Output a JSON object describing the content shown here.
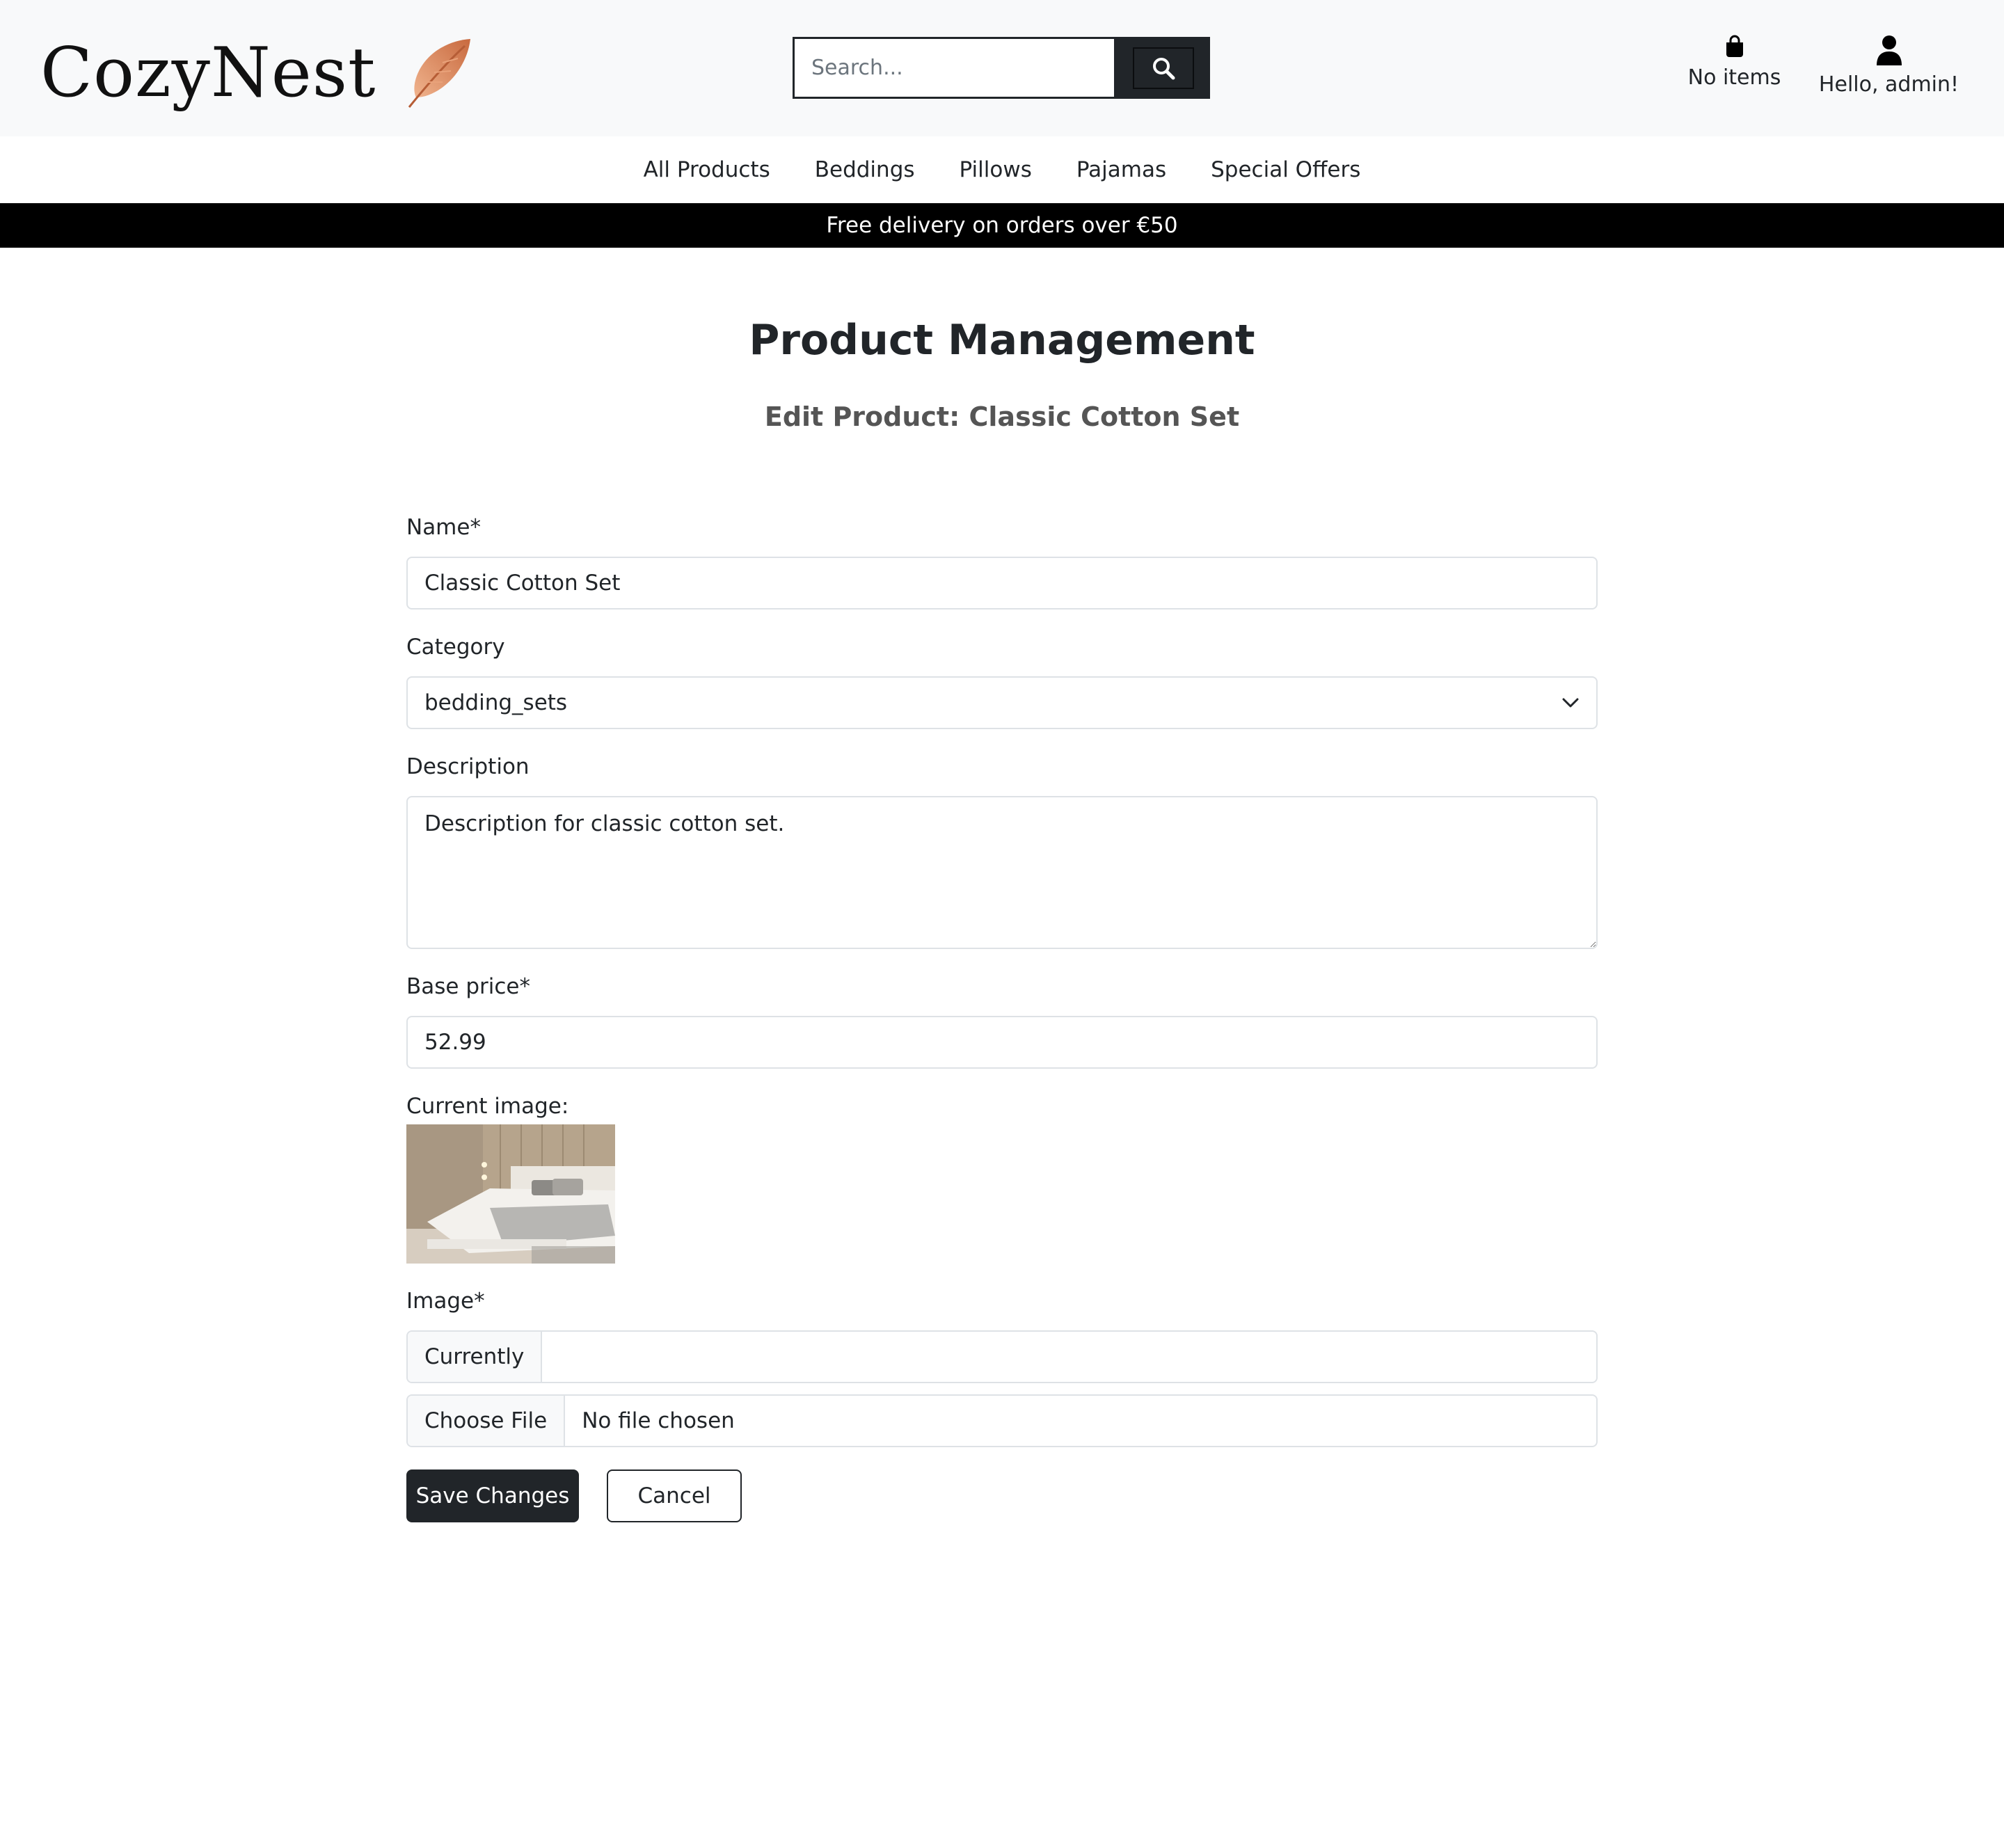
{
  "brand": {
    "name": "CozyNest",
    "icon": "feather-icon"
  },
  "search": {
    "placeholder": "Search...",
    "icon": "search-icon"
  },
  "header": {
    "bag_label": "No items",
    "user_label": "Hello, admin!"
  },
  "nav": {
    "items": [
      "All Products",
      "Beddings",
      "Pillows",
      "Pajamas",
      "Special Offers"
    ]
  },
  "banner": {
    "text": "Free delivery on orders over €50"
  },
  "page": {
    "title": "Product Management",
    "subtitle": "Edit Product: Classic Cotton Set"
  },
  "form": {
    "name_label": "Name*",
    "name_value": "Classic Cotton Set",
    "category_label": "Category",
    "category_value": "bedding_sets",
    "description_label": "Description",
    "description_value": "Description for classic cotton set.",
    "price_label": "Base price*",
    "price_value": "52.99",
    "current_image_label": "Current image:",
    "image_label": "Image*",
    "currently_label": "Currently",
    "currently_value": "",
    "choose_file_label": "Choose File",
    "no_file_label": "No file chosen",
    "save_label": "Save Changes",
    "cancel_label": "Cancel"
  },
  "colors": {
    "dark": "#212529",
    "banner_bg": "#000000",
    "header_bg": "#f8f9fa",
    "feather": "#d98a5e"
  }
}
